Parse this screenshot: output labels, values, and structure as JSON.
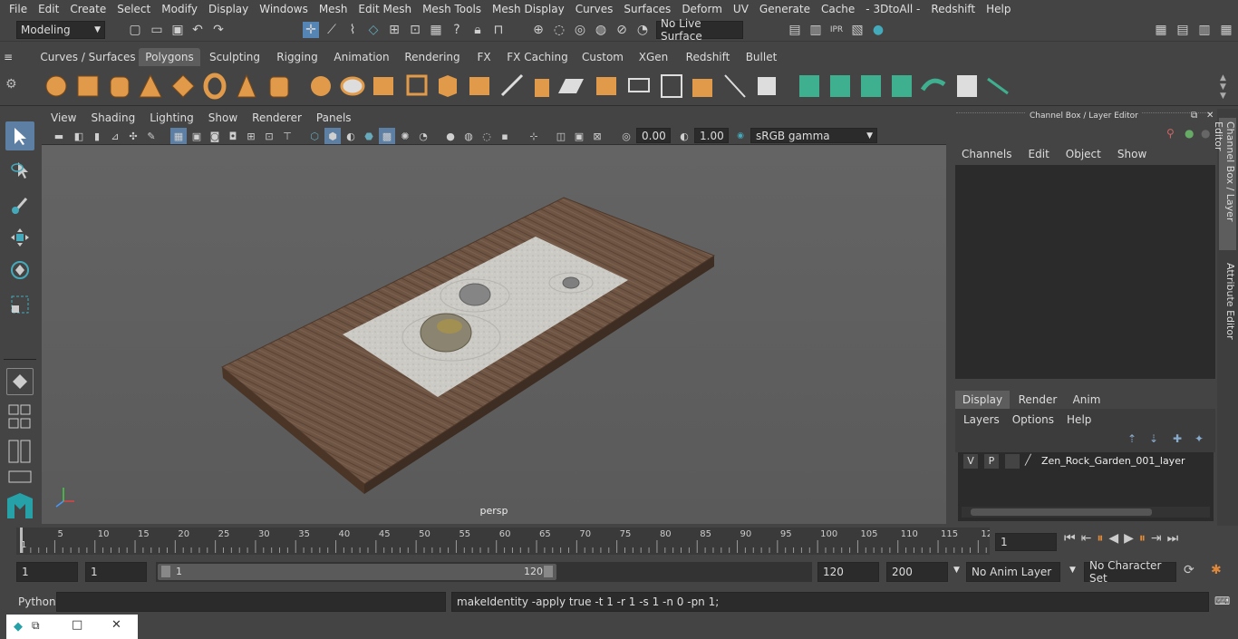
{
  "menubar": [
    "File",
    "Edit",
    "Create",
    "Select",
    "Modify",
    "Display",
    "Windows",
    "Mesh",
    "Edit Mesh",
    "Mesh Tools",
    "Mesh Display",
    "Curves",
    "Surfaces",
    "Deform",
    "UV",
    "Generate",
    "Cache",
    "- 3DtoAll -",
    "Redshift",
    "Help"
  ],
  "status": {
    "mode": "Modeling",
    "live_surface": "No Live Surface"
  },
  "shelf_tabs": [
    "Curves / Surfaces",
    "Polygons",
    "Sculpting",
    "Rigging",
    "Animation",
    "Rendering",
    "FX",
    "FX Caching",
    "Custom",
    "XGen",
    "Redshift",
    "Bullet"
  ],
  "shelf_active": "Polygons",
  "panel_menu": [
    "View",
    "Shading",
    "Lighting",
    "Show",
    "Renderer",
    "Panels"
  ],
  "panel_toolbar": {
    "exposure": "0.00",
    "gamma": "1.00",
    "colorspace": "sRGB gamma"
  },
  "viewport": {
    "camera_label": "persp"
  },
  "channel_box": {
    "title": "Channel Box / Layer Editor",
    "menu": [
      "Channels",
      "Edit",
      "Object",
      "Show"
    ],
    "layer_tabs": [
      "Display",
      "Render",
      "Anim"
    ],
    "layer_tab_active": "Display",
    "layer_menu": [
      "Layers",
      "Options",
      "Help"
    ],
    "layer": {
      "v": "V",
      "p": "P",
      "name": "Zen_Rock_Garden_001_layer"
    }
  },
  "side_tabs": [
    "Channel Box / Layer Editor",
    "Attribute Editor"
  ],
  "timeline": {
    "ticks": [
      "5",
      "10",
      "15",
      "20",
      "25",
      "30",
      "35",
      "40",
      "45",
      "50",
      "55",
      "60",
      "65",
      "70",
      "75",
      "80",
      "85",
      "90",
      "95",
      "100",
      "105",
      "110",
      "115",
      "12"
    ],
    "start_marker": "1",
    "current_frame": "1"
  },
  "range": {
    "start": "1",
    "playback_start": "1",
    "slider_start": "1",
    "slider_end": "120",
    "playback_end": "120",
    "end": "200",
    "anim_layer": "No Anim Layer",
    "char_set": "No Character Set"
  },
  "cmdline": {
    "lang": "Python",
    "feedback": "makeIdentity -apply true -t 1 -r 1 -s 1 -n 0 -pn 1;"
  }
}
